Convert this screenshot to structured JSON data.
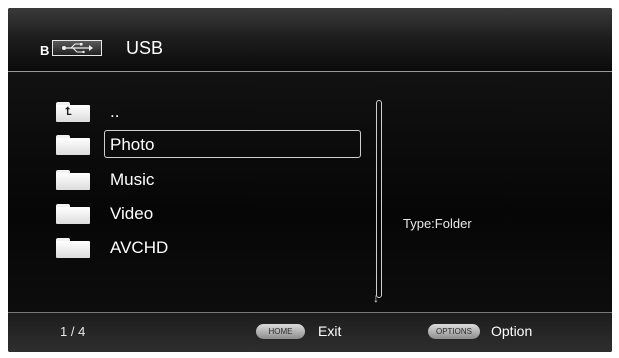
{
  "header": {
    "device_letter": "B",
    "usb_icon": "usb-icon",
    "title": "USB"
  },
  "list": {
    "items": [
      {
        "label": "..",
        "icon": "folder-up-icon"
      },
      {
        "label": "Photo",
        "icon": "folder-icon",
        "selected": true
      },
      {
        "label": "Music",
        "icon": "folder-icon"
      },
      {
        "label": "Video",
        "icon": "folder-icon"
      },
      {
        "label": "AVCHD",
        "icon": "folder-icon"
      }
    ]
  },
  "info": {
    "type_text": "Type:Folder"
  },
  "footer": {
    "page": "1 / 4",
    "home_key": "HOME",
    "exit_label": "Exit",
    "options_key": "OPTIONS",
    "option_label": "Option"
  },
  "colors": {
    "background": "#0b0b0b",
    "text": "#ffffff",
    "selection_border": "#d0d0d0"
  }
}
